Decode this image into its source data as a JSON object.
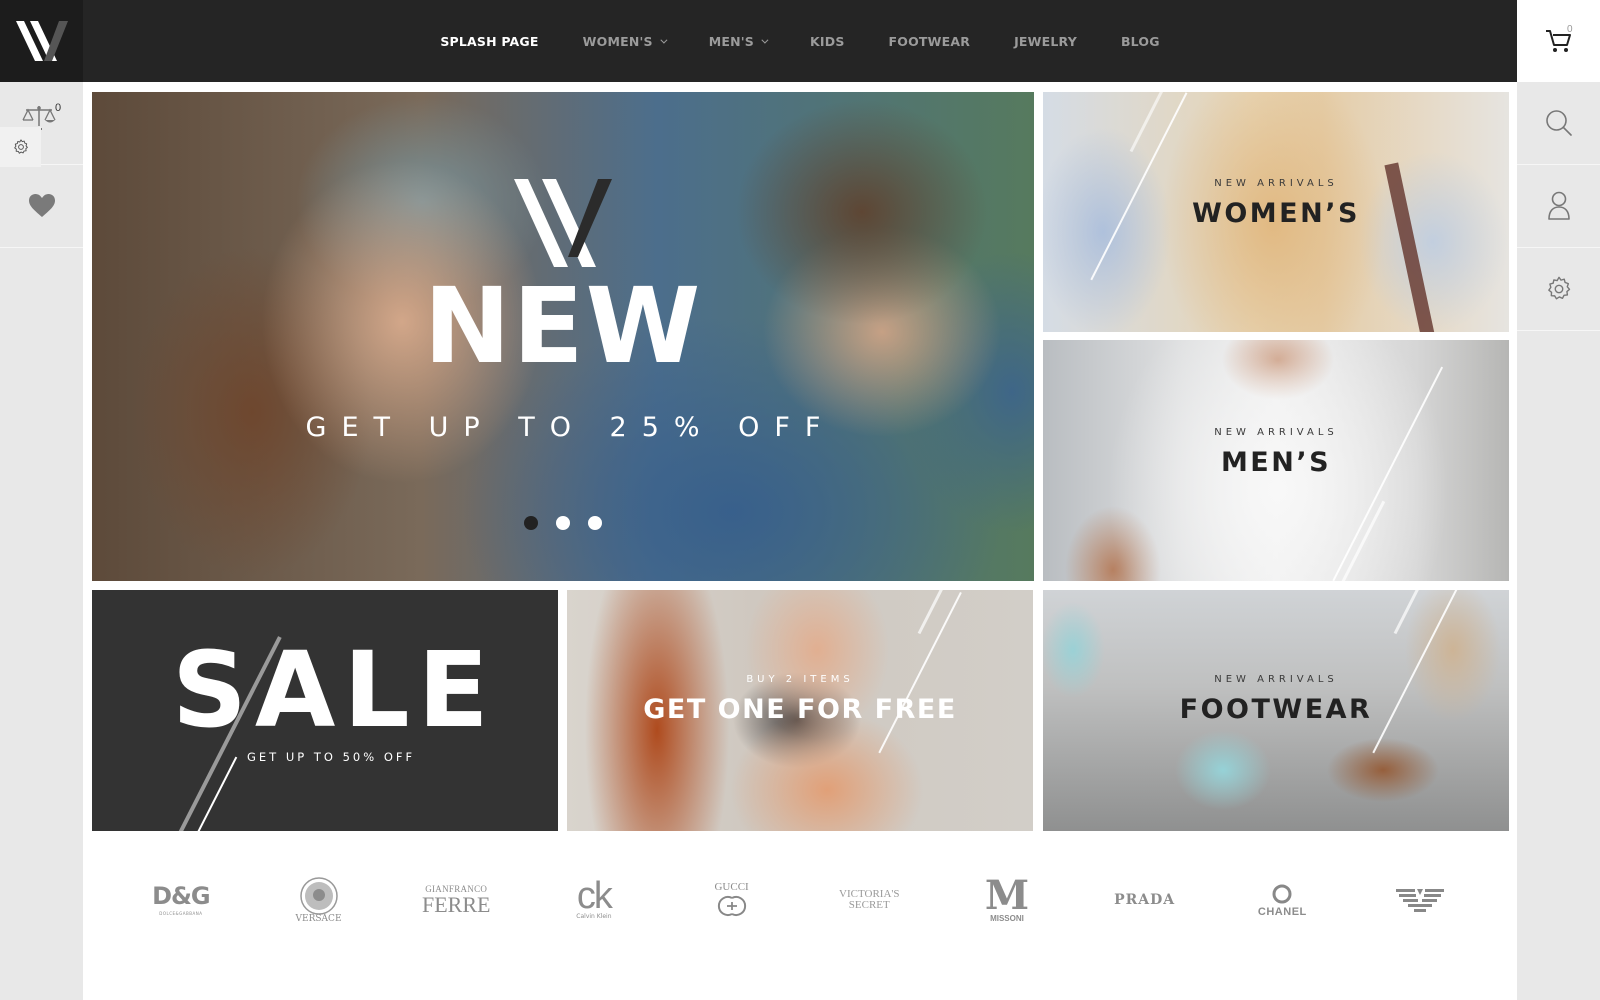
{
  "header": {
    "logo_alt": "W",
    "nav": [
      {
        "label": "SPLASH PAGE",
        "active": true,
        "has_dropdown": false
      },
      {
        "label": "WOMEN'S",
        "active": false,
        "has_dropdown": true
      },
      {
        "label": "MEN'S",
        "active": false,
        "has_dropdown": true
      },
      {
        "label": "KIDS",
        "active": false,
        "has_dropdown": false
      },
      {
        "label": "FOOTWEAR",
        "active": false,
        "has_dropdown": false
      },
      {
        "label": "JEWELRY",
        "active": false,
        "has_dropdown": false
      },
      {
        "label": "BLOG",
        "active": false,
        "has_dropdown": false
      }
    ],
    "cart": {
      "icon": "cart-icon",
      "count": "0"
    }
  },
  "sidebar_left": {
    "compare": {
      "icon": "scale-icon",
      "count": "0"
    },
    "settings_tab": {
      "icon": "gear-icon"
    },
    "wishlist": {
      "icon": "heart-icon"
    }
  },
  "sidebar_right": {
    "items": [
      {
        "icon": "search-icon"
      },
      {
        "icon": "user-icon"
      },
      {
        "icon": "gear-icon"
      }
    ]
  },
  "hero": {
    "title": "NEW",
    "subtitle": "GET UP TO 25% OFF",
    "slides_total": 3,
    "active_slide": 1
  },
  "tiles": {
    "women": {
      "eyebrow": "NEW ARRIVALS",
      "title": "WOMEN’S"
    },
    "men": {
      "eyebrow": "NEW ARRIVALS",
      "title": "MEN’S"
    },
    "sale": {
      "title": "SALE",
      "subtitle": "GET UP TO 50% OFF"
    },
    "promo": {
      "eyebrow": "BUY 2 ITEMS",
      "title": "GET ONE FOR FREE"
    },
    "footwear": {
      "eyebrow": "NEW ARRIVALS",
      "title": "FOOTWEAR"
    }
  },
  "brands": {
    "dg": {
      "main": "D&G",
      "sub": "DOLCE&GABBANA"
    },
    "versace": {
      "sub": "VERSACE"
    },
    "ferre": {
      "top": "GIANFRANCO",
      "main": "FERRE"
    },
    "ck": {
      "main": "ck",
      "sub": "Calvin Klein"
    },
    "gucci": {
      "main": "GUCCI"
    },
    "victorias_secret": {
      "line1": "VICTORIA'S",
      "line2": "SECRET"
    },
    "missoni": {
      "main": "M",
      "sub": "MISSONI"
    },
    "prada": {
      "main": "PRADA"
    },
    "chanel": {
      "main": "CHANEL"
    },
    "armani": {
      "icon": "armani-eagle-icon"
    }
  }
}
